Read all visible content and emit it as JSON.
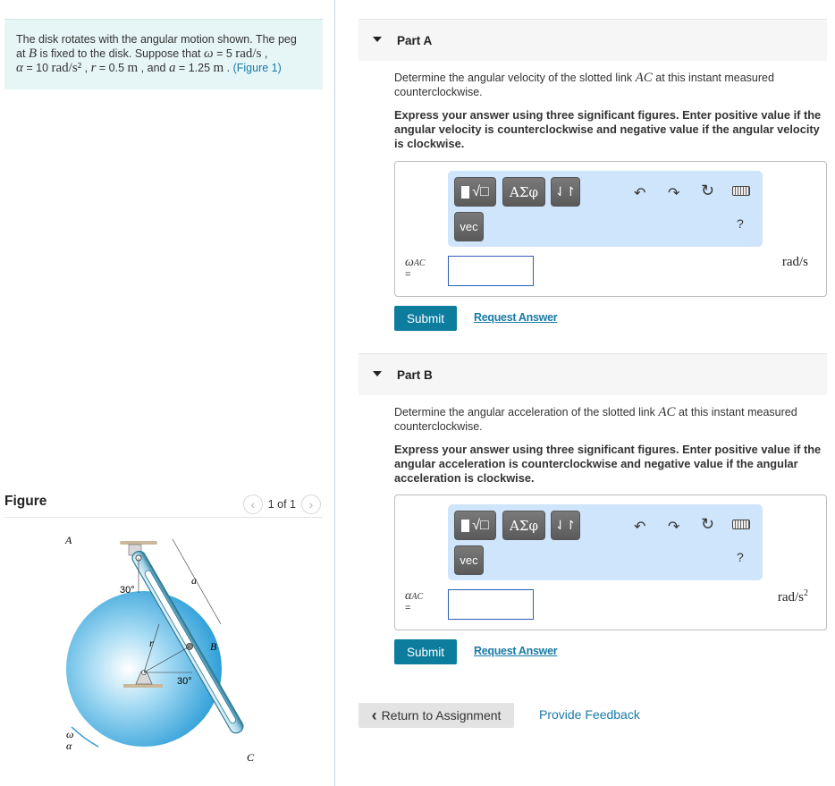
{
  "problem": {
    "line1": "The disk rotates with the angular motion shown. The peg",
    "line2_pre": "at ",
    "line2_B": "B",
    "line2_mid": " is fixed to the disk. Suppose that ",
    "omega_sym": "ω",
    "omega_val": " = 5 ",
    "omega_unit": "rad/s",
    "line2_end": " ,",
    "alpha_sym": "α",
    "alpha_val": " = 10 ",
    "alpha_unit": "rad/s²",
    "r_sep": " , ",
    "r_sym": "r",
    "r_val": " = 0.5 ",
    "r_unit": "m",
    "a_sep": " , and ",
    "a_sym": "a",
    "a_val": " = 1.25 ",
    "a_unit": "m",
    "end": " . ",
    "figure_link": "(Figure 1)"
  },
  "figure": {
    "title": "Figure",
    "pager_text": "1 of 1",
    "prev_icon": "chevron-left-icon",
    "next_icon": "chevron-right-icon",
    "labels": {
      "A": "A",
      "B": "B",
      "C": "C",
      "a": "a",
      "r": "r",
      "angle1": "30°",
      "angle2": "30°",
      "omega": "ω",
      "alpha": "α"
    }
  },
  "partA": {
    "label": "Part A",
    "question_pre": "Determine the angular velocity of the slotted link ",
    "question_var": "AC",
    "question_post": " at this instant measured counterclockwise.",
    "instruction": "Express your answer using three significant figures. Enter positive value if the angular velocity is counterclockwise and negative value if the angular velocity is clockwise.",
    "var_symbol": "ω",
    "var_sub": "AC",
    "eq": "=",
    "input_value": "",
    "unit": "rad/s",
    "submit": "Submit",
    "request_answer": "Request Answer"
  },
  "partB": {
    "label": "Part B",
    "question_pre": "Determine the angular acceleration of the slotted link ",
    "question_var": "AC",
    "question_post": " at this instant measured counterclockwise.",
    "instruction": "Express your answer using three significant figures. Enter positive value if the angular acceleration is counterclockwise and negative value if the angular acceleration is clockwise.",
    "var_symbol": "α",
    "var_sub": "AC",
    "eq": "=",
    "input_value": "",
    "unit": "rad/s",
    "unit_exp": "2",
    "submit": "Submit",
    "request_answer": "Request Answer"
  },
  "toolbar": {
    "greek_label": "ΑΣφ",
    "arrows_label": "⇃↾",
    "vec_label": "vec",
    "undo_glyph": "↶",
    "redo_glyph": "↷",
    "reset_glyph": "↻",
    "help_label": "?"
  },
  "footer": {
    "return_label": "Return to Assignment",
    "return_icon": "‹",
    "feedback_label": "Provide Feedback"
  },
  "colors": {
    "accent": "#0d7d9e",
    "link": "#1a7aa6",
    "problem_bg": "#e6f5f6",
    "toolbar_bg": "#cfe5fc"
  }
}
